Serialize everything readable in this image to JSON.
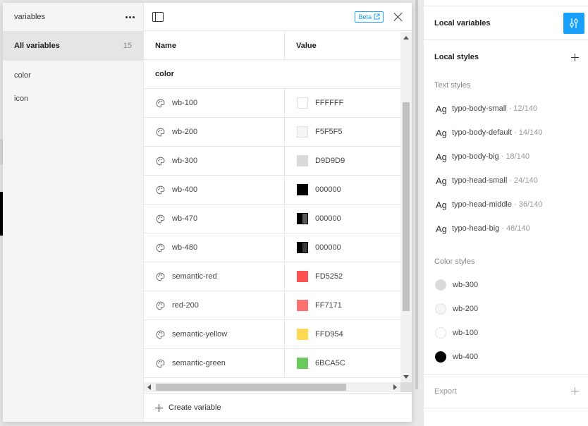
{
  "modal": {
    "collections_title": "variables",
    "all_variables": {
      "label": "All variables",
      "count": "15"
    },
    "groups": [
      "color",
      "icon"
    ],
    "beta_label": "Beta",
    "table": {
      "col_name": "Name",
      "col_value": "Value",
      "group_label": "color",
      "rows": [
        {
          "name": "wb-100",
          "value": "FFFFFF",
          "color": "#FFFFFF",
          "split": null
        },
        {
          "name": "wb-200",
          "value": "F5F5F5",
          "color": "#F5F5F5",
          "split": null
        },
        {
          "name": "wb-300",
          "value": "D9D9D9",
          "color": "#D9D9D9",
          "split": null
        },
        {
          "name": "wb-400",
          "value": "000000",
          "color": "#000000",
          "split": null
        },
        {
          "name": "wb-470",
          "value": "000000",
          "color": "#000000",
          "split": "#5a5a5a"
        },
        {
          "name": "wb-480",
          "value": "000000",
          "color": "#000000",
          "split": "#3a3a3a"
        },
        {
          "name": "semantic-red",
          "value": "FD5252",
          "color": "#FD5252",
          "split": null
        },
        {
          "name": "red-200",
          "value": "FF7171",
          "color": "#FF7171",
          "split": null
        },
        {
          "name": "semantic-yellow",
          "value": "FFD954",
          "color": "#FFD954",
          "split": null
        },
        {
          "name": "semantic-green",
          "value": "6BCA5C",
          "color": "#6BCA5C",
          "split": null
        }
      ]
    },
    "create_variable": "Create variable"
  },
  "panel": {
    "local_variables": "Local variables",
    "local_styles": "Local styles",
    "text_styles_label": "Text styles",
    "text_styles": [
      {
        "glyph": "Ag",
        "name": "typo-body-small",
        "meta": "· 12/140"
      },
      {
        "glyph": "Ag",
        "name": "typo-body-default",
        "meta": "· 14/140"
      },
      {
        "glyph": "Ag",
        "name": "typo-body-big",
        "meta": "· 18/140"
      },
      {
        "glyph": "Ag",
        "name": "typo-head-small",
        "meta": "· 24/140"
      },
      {
        "glyph": "Ag",
        "name": "typo-head-middle",
        "meta": "· 36/140"
      },
      {
        "glyph": "Ag",
        "name": "typo-head-big",
        "meta": "· 48/140"
      }
    ],
    "color_styles_label": "Color styles",
    "color_styles": [
      {
        "name": "wb-300",
        "color": "#D9D9D9"
      },
      {
        "name": "wb-200",
        "color": "#F5F5F5"
      },
      {
        "name": "wb-100",
        "color": "#FFFFFF"
      },
      {
        "name": "wb-400",
        "color": "#000000"
      }
    ],
    "export": "Export"
  },
  "colors": {
    "accent": "#18A0FB"
  }
}
